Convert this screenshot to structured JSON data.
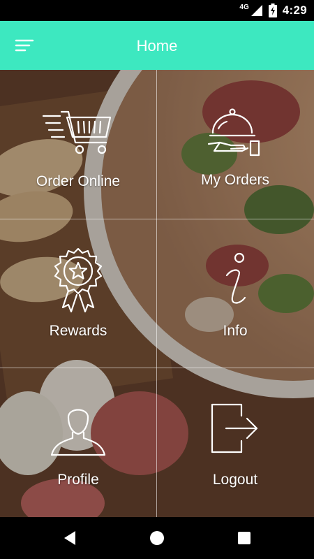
{
  "status_bar": {
    "network": "4G",
    "time": "4:29"
  },
  "app_bar": {
    "title": "Home"
  },
  "menu": {
    "order_online": "Order Online",
    "my_orders": "My Orders",
    "rewards": "Rewards",
    "info": "Info",
    "profile": "Profile",
    "logout": "Logout"
  },
  "colors": {
    "accent": "#3de8c0"
  },
  "icons": {
    "menu": "sort-menu-icon",
    "order_online": "shopping-cart-icon",
    "my_orders": "serving-cloche-icon",
    "rewards": "award-badge-icon",
    "info": "info-icon",
    "profile": "user-profile-icon",
    "logout": "logout-icon"
  }
}
